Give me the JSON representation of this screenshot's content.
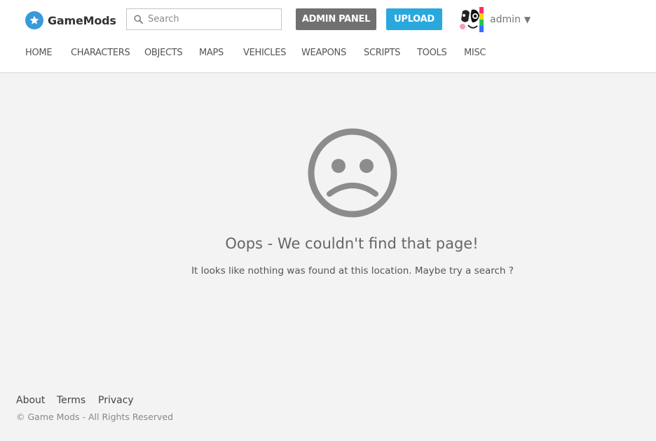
{
  "brand": {
    "name": "GameMods",
    "logo_icon": "star-icon",
    "accent": "#3a9ad9"
  },
  "search": {
    "placeholder": "Search",
    "value": ""
  },
  "header_buttons": {
    "admin_label": "ADMIN PANEL",
    "upload_label": "UPLOAD",
    "admin_color": "#707070",
    "upload_color": "#29a8de"
  },
  "user": {
    "name": "admin",
    "caret": "▼"
  },
  "nav": {
    "items": [
      "HOME",
      "CHARACTERS",
      "OBJECTS",
      "MAPS",
      "VEHICLES",
      "WEAPONS",
      "SCRIPTS",
      "TOOLS",
      "MISC"
    ]
  },
  "error": {
    "icon": "sad-face-icon",
    "title": "Oops - We couldn't find that page!",
    "message": "It looks like nothing was found at this location. Maybe try a search ?"
  },
  "footer": {
    "links": [
      "About",
      "Terms",
      "Privacy"
    ],
    "copyright": "© Game Mods - All Rights Reserved"
  }
}
